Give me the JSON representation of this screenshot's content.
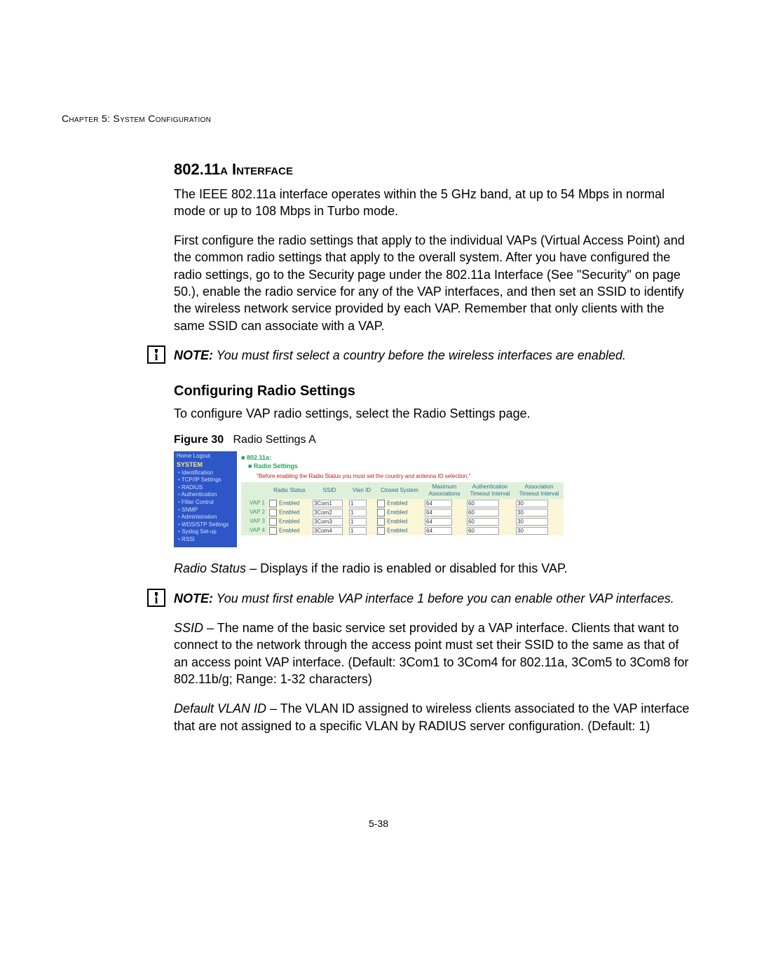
{
  "running_head": "Chapter 5: System Configuration",
  "section_title_pre": "802.11",
  "section_title_sc": "a Interface",
  "para1": "The IEEE 802.11a interface operates within the 5 GHz band, at up to 54 Mbps in normal mode or up to 108 Mbps in Turbo mode.",
  "para2": "First configure the radio settings that apply to the individual VAPs (Virtual Access Point) and the common radio settings that apply to the overall system. After you have configured the radio settings, go to the Security page under the 802.11a Interface (See \"Security\" on page 50.), enable the radio service for any of the VAP interfaces, and then set an SSID to identify the wireless network service provided by each VAP. Remember that only clients with the same SSID can associate with a VAP.",
  "note1_label": "NOTE:",
  "note1_text": " You must first select a country before the wireless interfaces are enabled.",
  "subsection_title": "Configuring Radio Settings",
  "para3": "To configure VAP radio settings, select the Radio Settings page.",
  "figure_label": "Figure 30",
  "figure_caption": "Radio Settings A",
  "radio_status_term": "Radio Status",
  "radio_status_text": " – Displays if the radio is enabled or disabled for this VAP.",
  "note2_label": "NOTE:",
  "note2_text": " You must first enable VAP interface 1 before you can enable other VAP interfaces.",
  "ssid_term": "SSID",
  "ssid_text": " – The name of the basic service set provided by a VAP interface. Clients that want to connect to the network through the access point must set their SSID to the same as that of an access point VAP interface. (Default: 3Com1 to 3Com4 for 802.11a, 3Com5 to 3Com8 for 802.11b/g; Range: 1-32 characters)",
  "vlan_term": "Default VLAN ID",
  "vlan_text": " – The VLAN ID assigned to wireless clients associated to the VAP interface that are not assigned to a specific VLAN by RADIUS server configuration. (Default: 1)",
  "page_number": "5-38",
  "shot": {
    "topnav": "Home   Logout",
    "group": "SYSTEM",
    "items": [
      "Identification",
      "TCP/IP Settings",
      "RADIUS",
      "Authentication",
      "Filter Control",
      "SNMP",
      "Administration",
      "WDS/STP Settings",
      "Syslog Set-up",
      "RSSI"
    ],
    "crumb": "■  802.11a:",
    "sub": "■ Radio Settings",
    "warn": "\"Before enabling the Radio Status you must set the country and antenna ID selection.\"",
    "headers": [
      "",
      "Radio Status",
      "SSID",
      "Vlan ID",
      "Closed System",
      "Maximum Associations",
      "Authentication Timeout Interval",
      "Association Timeout Interval"
    ],
    "rows": [
      {
        "name": "VAP 1",
        "rs": "Enabled",
        "ssid": "3Com1",
        "vlan": "1",
        "cs": "Enabled",
        "max": "64",
        "auth": "60",
        "assoc": "30"
      },
      {
        "name": "VAP 2",
        "rs": "Enabled",
        "ssid": "3Com2",
        "vlan": "1",
        "cs": "Enabled",
        "max": "64",
        "auth": "60",
        "assoc": "30"
      },
      {
        "name": "VAP 3",
        "rs": "Enabled",
        "ssid": "3Com3",
        "vlan": "1",
        "cs": "Enabled",
        "max": "64",
        "auth": "60",
        "assoc": "30"
      },
      {
        "name": "VAP 4",
        "rs": "Enabled",
        "ssid": "3Com4",
        "vlan": "1",
        "cs": "Enabled",
        "max": "64",
        "auth": "60",
        "assoc": "30"
      }
    ]
  }
}
